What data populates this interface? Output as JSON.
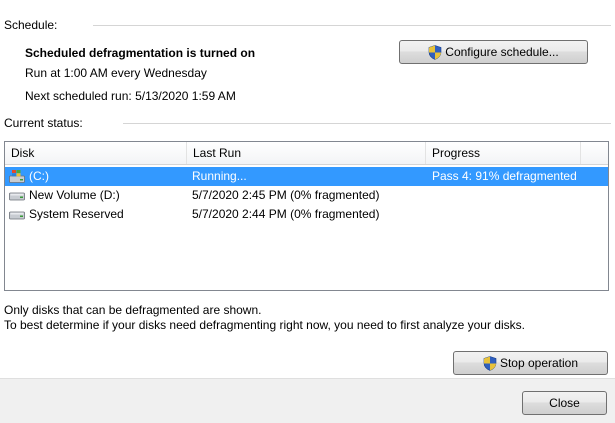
{
  "schedule": {
    "section_label": "Schedule:",
    "status_title": "Scheduled defragmentation is turned on",
    "frequency": "Run at 1:00 AM every Wednesday",
    "next_run": "Next scheduled run: 5/13/2020 1:59 AM",
    "configure_button": "Configure schedule..."
  },
  "current_status": {
    "section_label": "Current status:",
    "columns": [
      "Disk",
      "Last Run",
      "Progress"
    ],
    "rows": [
      {
        "disk": "(C:)",
        "last_run": "Running...",
        "progress": "Pass 4: 91% defragmented",
        "icon": "windows-drive-icon",
        "selected": true
      },
      {
        "disk": "New Volume (D:)",
        "last_run": "5/7/2020 2:45 PM (0% fragmented)",
        "progress": "",
        "icon": "hard-drive-icon",
        "selected": false
      },
      {
        "disk": "System Reserved",
        "last_run": "5/7/2020 2:44 PM (0% fragmented)",
        "progress": "",
        "icon": "hard-drive-icon",
        "selected": false
      }
    ]
  },
  "info": {
    "line1": "Only disks that can be defragmented are shown.",
    "line2": "To best determine if your disks need defragmenting right now, you need to first analyze your disks."
  },
  "actions": {
    "stop_button": "Stop operation",
    "close_button": "Close"
  },
  "colors": {
    "selection": "#3399ff",
    "border": "#828790"
  }
}
